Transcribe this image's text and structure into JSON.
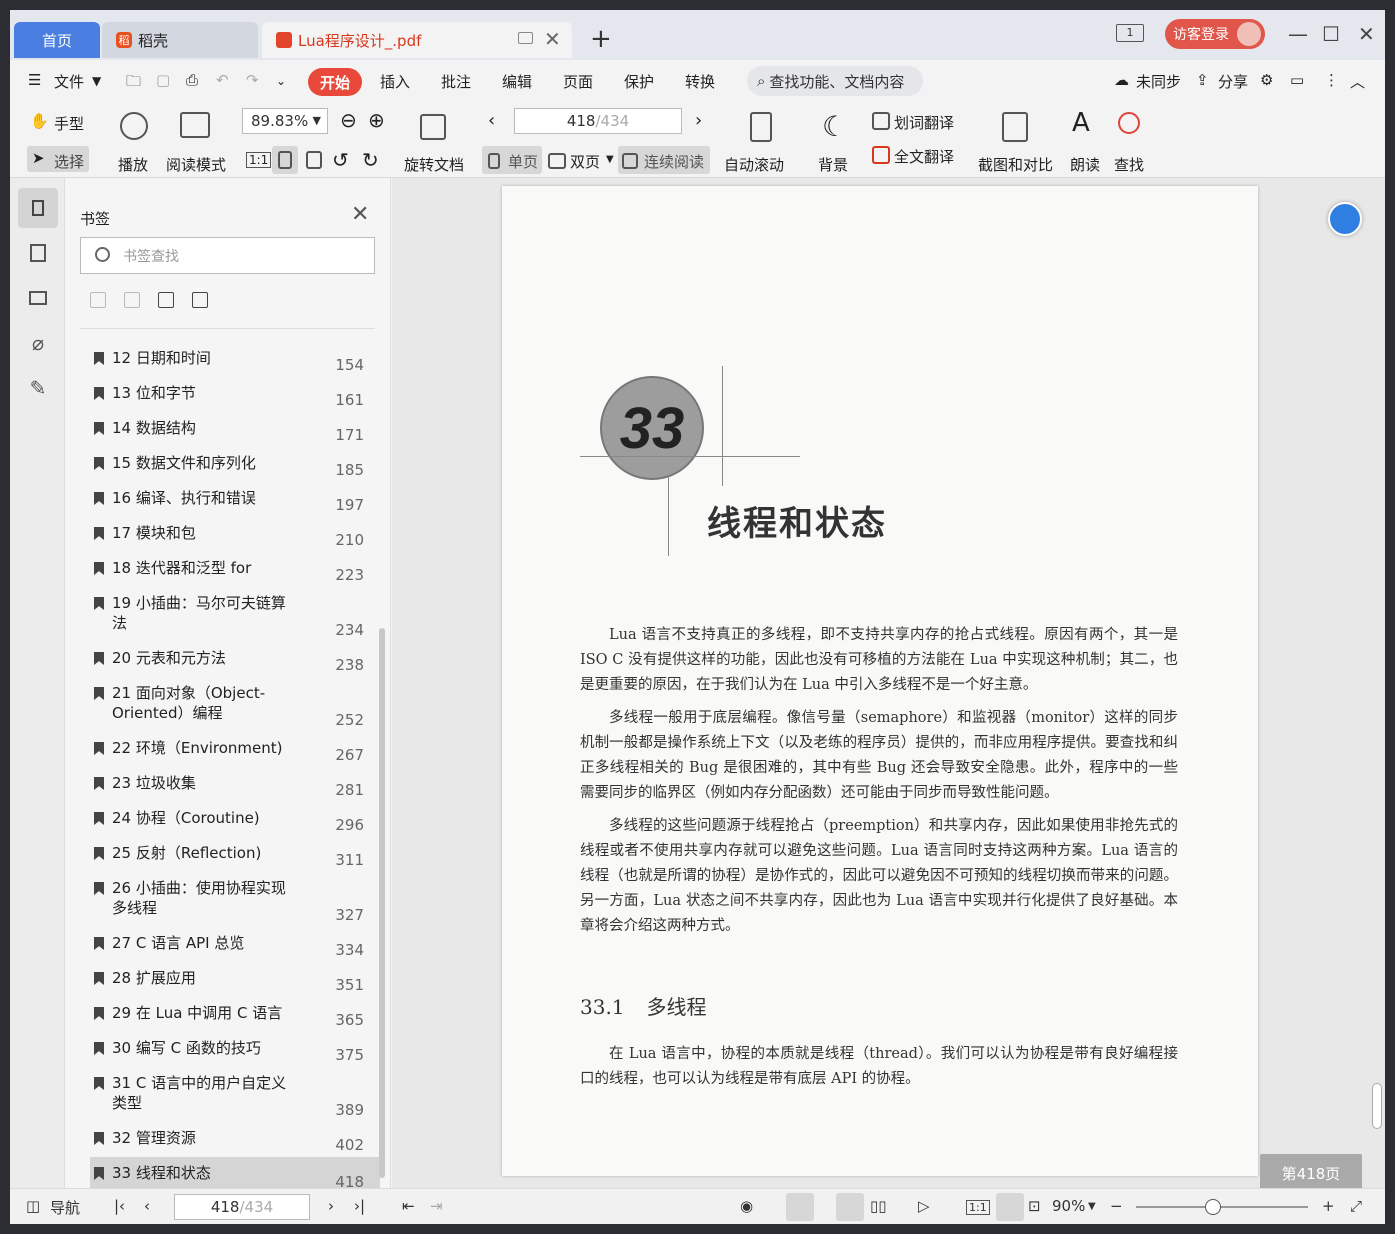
{
  "tabs": {
    "home": "首页",
    "daoke": "稻壳",
    "document": "Lua程序设计_.pdf",
    "new_tab": "+"
  },
  "titlebar": {
    "window_count": "1",
    "login": "访客登录",
    "minimize": "—",
    "maximize": "☐",
    "close": "✕"
  },
  "menu": {
    "file": "文件",
    "start": "开始",
    "insert": "插入",
    "annotate": "批注",
    "edit": "编辑",
    "page": "页面",
    "protect": "保护",
    "convert": "转换",
    "search_placeholder": "查找功能、文档内容",
    "sync": "未同步",
    "share": "分享"
  },
  "toolbar": {
    "hand": "手型",
    "select": "选择",
    "play": "播放",
    "read_mode": "阅读模式",
    "zoom": "89.83%",
    "rotate": "旋转文档",
    "page_current": "418",
    "page_total": "/434",
    "single": "单页",
    "double": "双页",
    "continuous": "连续阅读",
    "auto_scroll": "自动滚动",
    "background": "背景",
    "word_translate": "划词翻译",
    "full_translate": "全文翻译",
    "screenshot_compare": "截图和对比",
    "read_aloud": "朗读",
    "find": "查找"
  },
  "bookmarks": {
    "title": "书签",
    "search_placeholder": "书签查找",
    "items": [
      {
        "label": "12 日期和时间",
        "page": "154"
      },
      {
        "label": "13 位和字节",
        "page": "161"
      },
      {
        "label": "14 数据结构",
        "page": "171"
      },
      {
        "label": "15 数据文件和序列化",
        "page": "185"
      },
      {
        "label": "16 编译、执行和错误",
        "page": "197"
      },
      {
        "label": "17 模块和包",
        "page": "210"
      },
      {
        "label": "18 迭代器和泛型 for",
        "page": "223"
      },
      {
        "label": "19 小插曲：马尔可夫链算法",
        "page": "234"
      },
      {
        "label": "20 元表和元方法",
        "page": "238"
      },
      {
        "label": "21 面向对象（Object-Oriented）编程",
        "page": "252"
      },
      {
        "label": "22 环境（Environment)",
        "page": "267"
      },
      {
        "label": "23 垃圾收集",
        "page": "281"
      },
      {
        "label": "24 协程（Coroutine)",
        "page": "296"
      },
      {
        "label": "25 反射（Reflection)",
        "page": "311"
      },
      {
        "label": "26 小插曲：使用协程实现多线程",
        "page": "327"
      },
      {
        "label": "27 C 语言 API 总览",
        "page": "334"
      },
      {
        "label": "28 扩展应用",
        "page": "351"
      },
      {
        "label": "29 在 Lua 中调用 C 语言",
        "page": "365"
      },
      {
        "label": "30 编写 C 函数的技巧",
        "page": "375"
      },
      {
        "label": "31 C 语言中的用户自定义类型",
        "page": "389"
      },
      {
        "label": "32 管理资源",
        "page": "402"
      },
      {
        "label": "33 线程和状态",
        "page": "418"
      }
    ]
  },
  "document": {
    "chapter_number": "33",
    "chapter_title": "线程和状态",
    "paragraphs": [
      "Lua 语言不支持真正的多线程，即不支持共享内存的抢占式线程。原因有两个，其一是 ISO C 没有提供这样的功能，因此也没有可移植的方法能在 Lua 中实现这种机制；其二，也是更重要的原因，在于我们认为在 Lua 中引入多线程不是一个好主意。",
      "多线程一般用于底层编程。像信号量（semaphore）和监视器（monitor）这样的同步机制一般都是操作系统上下文（以及老练的程序员）提供的，而非应用程序提供。要查找和纠正多线程相关的 Bug 是很困难的，其中有些 Bug 还会导致安全隐患。此外，程序中的一些需要同步的临界区（例如内存分配函数）还可能由于同步而导致性能问题。",
      "多线程的这些问题源于线程抢占（preemption）和共享内存，因此如果使用非抢先式的线程或者不使用共享内存就可以避免这些问题。Lua 语言同时支持这两种方案。Lua 语言的线程（也就是所谓的协程）是协作式的，因此可以避免因不可预知的线程切换而带来的问题。另一方面，Lua 状态之间不共享内存，因此也为 Lua 语言中实现并行化提供了良好基础。本章将会介绍这两种方式。"
    ],
    "section_number": "33.1",
    "section_title": "多线程",
    "section_paragraph": "在 Lua 语言中，协程的本质就是线程（thread）。我们可以认为协程是带有良好编程接口的线程，也可以认为线程是带有底层 API 的协程。",
    "page_tip": "第418页"
  },
  "statusbar": {
    "nav": "导航",
    "page_current": "418",
    "page_total": "/434",
    "zoom": "90%"
  }
}
